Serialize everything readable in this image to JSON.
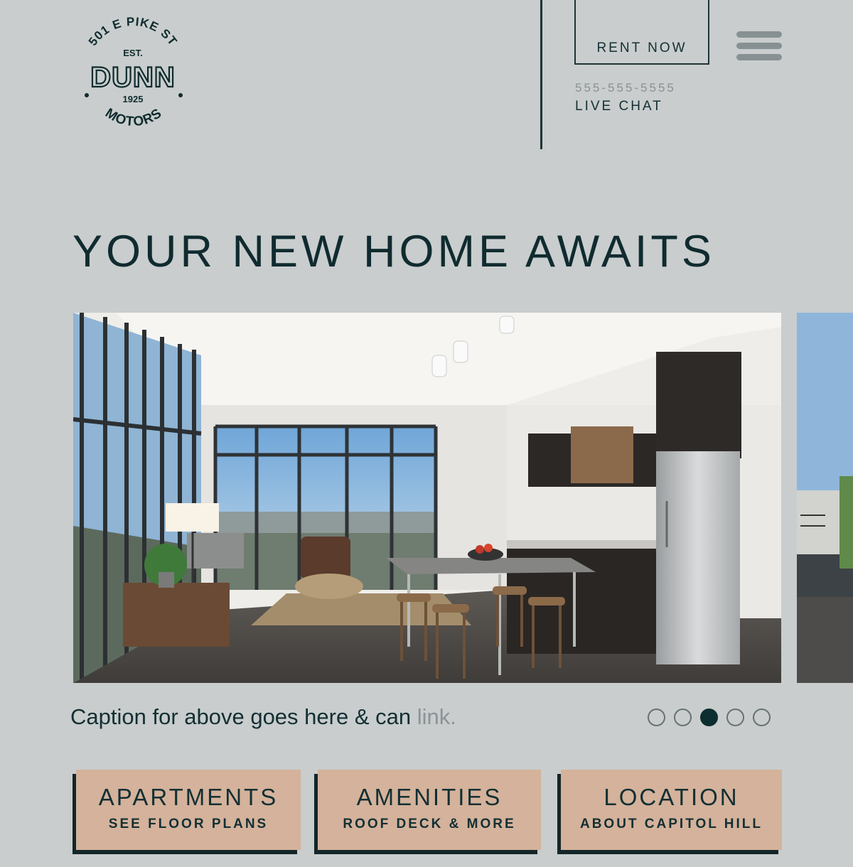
{
  "logo": {
    "top_arc": "501 E PIKE ST",
    "est": "EST.",
    "name": "DUNN",
    "year": "1925",
    "bottom_arc": "MOTORS"
  },
  "header": {
    "rent_label": "RENT NOW",
    "phone": "555-555-5555",
    "chat_label": "LIVE CHAT",
    "menu_icon": "hamburger-menu-icon"
  },
  "hero": {
    "headline": "YOUR NEW HOME AWAITS",
    "caption_text": "Caption for above goes here & can ",
    "caption_link": "link.",
    "slide_count": 5,
    "active_slide": 3
  },
  "cards": [
    {
      "title": "APARTMENTS",
      "subtitle": "SEE FLOOR PLANS"
    },
    {
      "title": "AMENITIES",
      "subtitle": "ROOF DECK & MORE"
    },
    {
      "title": "LOCATION",
      "subtitle": "ABOUT CAPITOL HILL"
    }
  ],
  "colors": {
    "background": "#c9cdcd",
    "text_dark": "#0f2b2e",
    "card": "#d4b29b",
    "muted": "#8a9294"
  }
}
